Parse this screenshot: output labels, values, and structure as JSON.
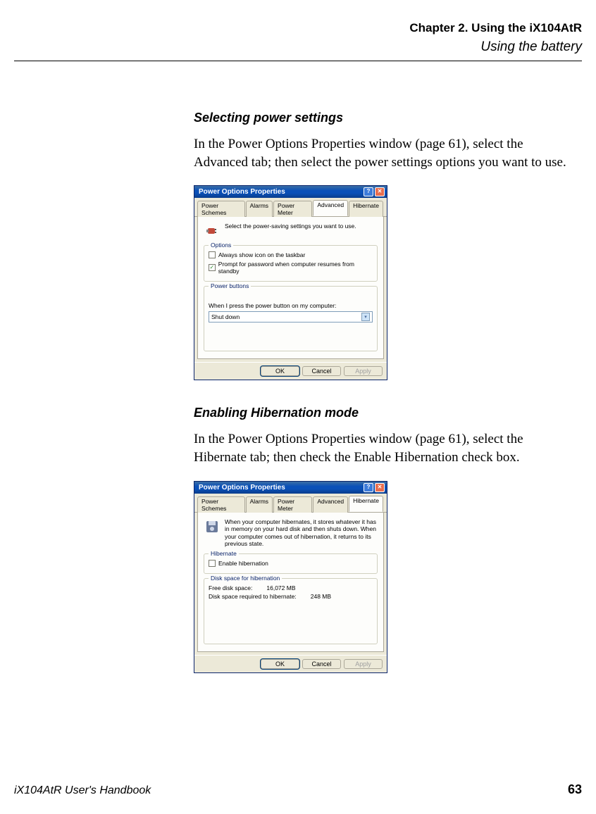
{
  "header": {
    "chapter": "Chapter 2. Using the iX104AtR",
    "section": "Using the battery"
  },
  "sections": {
    "power": {
      "heading": "Selecting power settings",
      "body": "In the Power Options Properties window (page 61), select the Advanced tab; then select the power settings options you want to use."
    },
    "hibernate": {
      "heading": "Enabling Hibernation mode",
      "body": "In the Power Options Properties window (page 61), select the Hibernate tab; then check the Enable Hibernation check box."
    }
  },
  "dialog1": {
    "title": "Power Options Properties",
    "tabs": [
      "Power Schemes",
      "Alarms",
      "Power Meter",
      "Advanced",
      "Hibernate"
    ],
    "active_tab": "Advanced",
    "intro": "Select the power-saving settings you want to use.",
    "options_group": "Options",
    "opt_show_icon": "Always show icon on the taskbar",
    "opt_show_icon_checked": false,
    "opt_prompt_pw": "Prompt for password when computer resumes from standby",
    "opt_prompt_pw_checked": true,
    "power_buttons_group": "Power buttons",
    "power_button_label": "When I press the power button on my computer:",
    "power_button_value": "Shut down",
    "buttons": {
      "ok": "OK",
      "cancel": "Cancel",
      "apply": "Apply"
    }
  },
  "dialog2": {
    "title": "Power Options Properties",
    "tabs": [
      "Power Schemes",
      "Alarms",
      "Power Meter",
      "Advanced",
      "Hibernate"
    ],
    "active_tab": "Hibernate",
    "intro": "When your computer hibernates, it stores whatever it has in memory on your hard disk and then shuts down. When your computer comes out of hibernation, it returns to its previous state.",
    "hibernate_group": "Hibernate",
    "enable_hib": "Enable hibernation",
    "enable_hib_checked": false,
    "disk_group": "Disk space for hibernation",
    "free_space_label": "Free disk space:",
    "free_space_value": "16,072 MB",
    "req_space_label": "Disk space required to hibernate:",
    "req_space_value": "248 MB",
    "buttons": {
      "ok": "OK",
      "cancel": "Cancel",
      "apply": "Apply"
    }
  },
  "footer": {
    "left": "iX104AtR User's Handbook",
    "right": "63"
  }
}
